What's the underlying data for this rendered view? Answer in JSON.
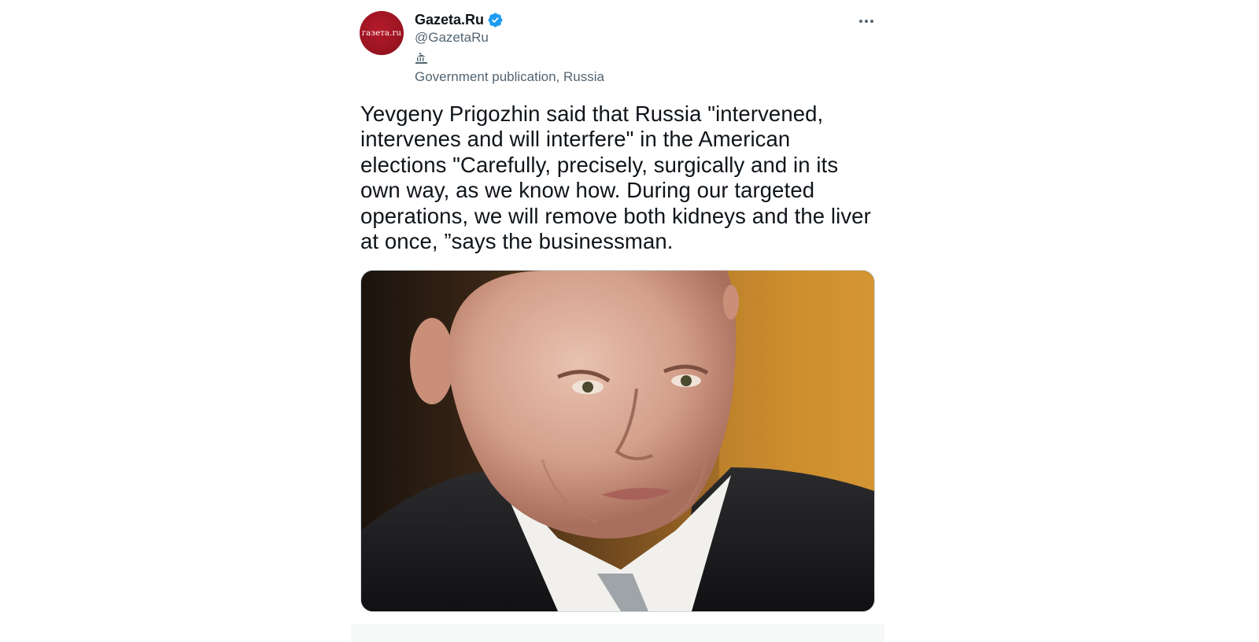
{
  "account": {
    "display_name": "Gazeta.Ru",
    "handle": "@GazetaRu",
    "avatar_text": "газета.ru",
    "label": "Government publication, Russia",
    "verified": true
  },
  "tweet": {
    "text": "Yevgeny Prigozhin said that Russia \"intervened, intervenes and will interfere\" in the American elections \"Carefully, precisely, surgically and in its own way, as we know how. During our targeted operations, we will remove both kidneys and the liver at once, ”says the businessman.",
    "more_menu_icon": "more-horizontal-icon"
  },
  "media": {
    "description_icon": "photo"
  },
  "colors": {
    "brand_red": "#9c1422",
    "verified_blue": "#1d9bf0",
    "text_primary": "#0f1419",
    "text_secondary": "#536471"
  }
}
